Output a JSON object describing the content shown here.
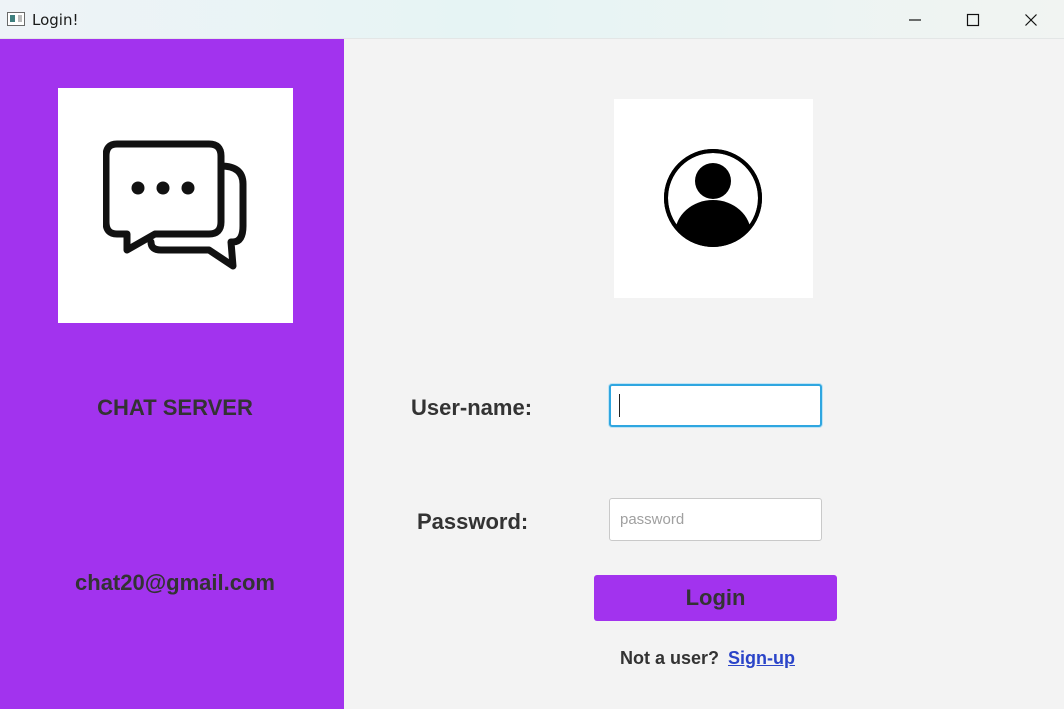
{
  "window": {
    "title": "Login!",
    "controls": [
      "minimize-icon",
      "maximize-icon",
      "close-icon"
    ]
  },
  "sidebar": {
    "logo_icon": "chat-bubbles-icon",
    "title": "CHAT SERVER",
    "email": "chat20@gmail.com",
    "background": "#a233ee"
  },
  "login_form": {
    "avatar_icon": "user-avatar-icon",
    "username_label": "User-name:",
    "username_value": "",
    "password_label": "Password:",
    "password_value": "",
    "password_placeholder": "password",
    "login_button": "Login",
    "signup_prompt": "Not a user?",
    "signup_link": "Sign-up"
  },
  "colors": {
    "accent": "#a233ee",
    "focus_border": "#2fa6e0",
    "link": "#2a44c8",
    "text": "#333333"
  }
}
